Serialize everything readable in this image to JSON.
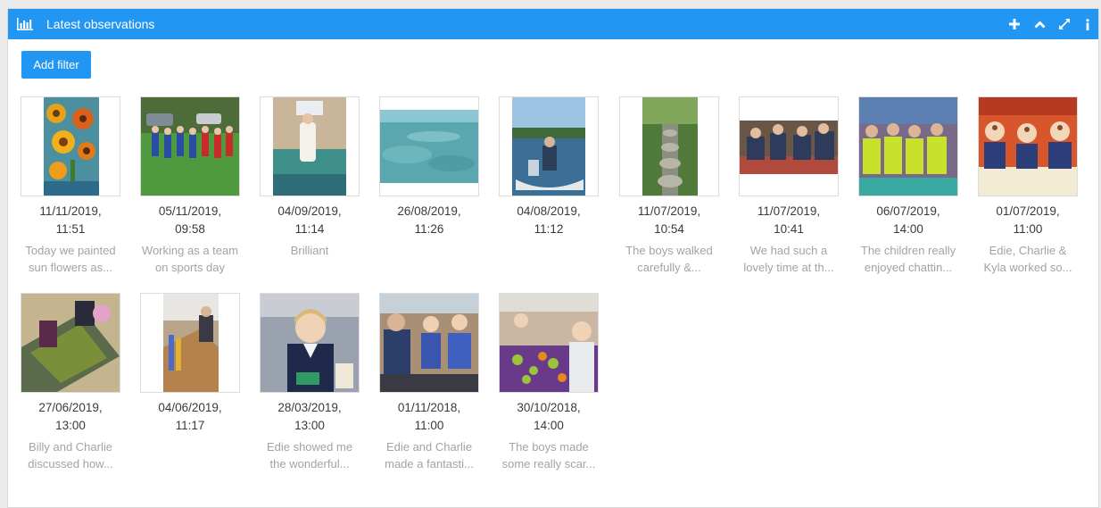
{
  "widget": {
    "title": "Latest observations",
    "icons": [
      "bar-chart-icon",
      "plus-icon",
      "chevron-up-icon",
      "expand-icon",
      "info-icon"
    ],
    "accent": "#2196f3"
  },
  "toolbar": {
    "add_filter_label": "Add filter"
  },
  "observations": [
    {
      "date": "11/11/2019,",
      "time": "11:51",
      "caption": [
        "Today we painted",
        "sun flowers as..."
      ],
      "photo": "sunflower-painting"
    },
    {
      "date": "05/11/2019,",
      "time": "09:58",
      "caption": [
        "Working as a team",
        "on sports day"
      ],
      "photo": "sports-day-team"
    },
    {
      "date": "04/09/2019,",
      "time": "11:14",
      "caption": [
        "Brilliant",
        ""
      ],
      "photo": "child-in-bedroom"
    },
    {
      "date": "26/08/2019,",
      "time": "11:26",
      "caption": [
        "",
        ""
      ],
      "photo": "underwater-sea"
    },
    {
      "date": "04/08/2019,",
      "time": "11:12",
      "caption": [
        "",
        ""
      ],
      "photo": "boat-on-lake"
    },
    {
      "date": "11/07/2019,",
      "time": "10:54",
      "caption": [
        "The boys walked",
        "carefully &..."
      ],
      "photo": "stepping-stones"
    },
    {
      "date": "11/07/2019,",
      "time": "10:41",
      "caption": [
        "We had such a",
        "lovely time at th..."
      ],
      "photo": "children-at-table"
    },
    {
      "date": "06/07/2019,",
      "time": "14:00",
      "caption": [
        "The children really",
        "enjoyed chattin..."
      ],
      "photo": "children-hi-vis"
    },
    {
      "date": "01/07/2019,",
      "time": "11:00",
      "caption": [
        "Edie, Charlie &",
        "Kyla worked so..."
      ],
      "photo": "children-masks"
    },
    {
      "date": "27/06/2019,",
      "time": "13:00",
      "caption": [
        "Billy and Charlie",
        "discussed how..."
      ],
      "photo": "play-mat"
    },
    {
      "date": "04/06/2019,",
      "time": "11:17",
      "caption": [
        "",
        ""
      ],
      "photo": "child-with-blocks"
    },
    {
      "date": "28/03/2019,",
      "time": "13:00",
      "caption": [
        "Edie showed me",
        "the wonderful..."
      ],
      "photo": "girl-uniform"
    },
    {
      "date": "01/11/2018,",
      "time": "11:00",
      "caption": [
        "Edie and Charlie",
        "made a fantasti..."
      ],
      "photo": "children-adult"
    },
    {
      "date": "30/10/2018,",
      "time": "14:00",
      "caption": [
        "The boys made",
        "some really scar..."
      ],
      "photo": "pumpkin-craft"
    }
  ]
}
